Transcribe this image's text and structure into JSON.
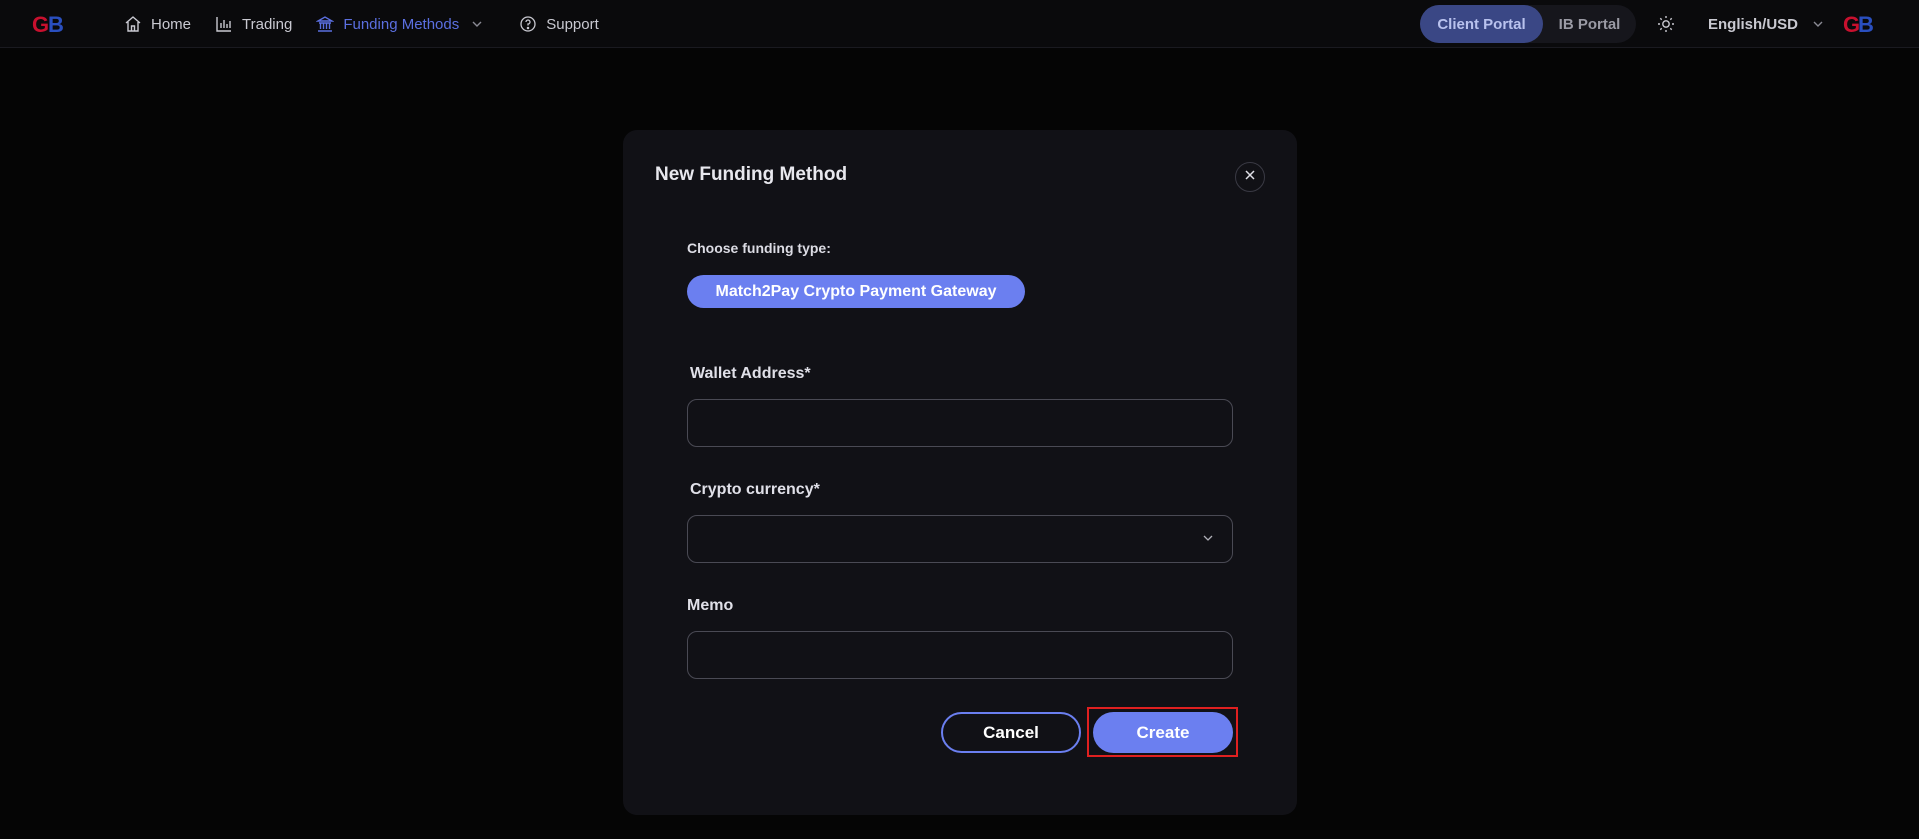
{
  "nav": {
    "items": [
      {
        "label": "Home",
        "icon": "home-icon"
      },
      {
        "label": "Trading",
        "icon": "chart-icon"
      },
      {
        "label": "Funding Methods",
        "icon": "bank-icon",
        "active": true,
        "has_dropdown": true
      },
      {
        "label": "Support",
        "icon": "help-circle-icon"
      }
    ],
    "portals": {
      "client": "Client Portal",
      "ib": "IB Portal",
      "active": "client"
    },
    "language": "English/USD",
    "theme_icon": "sun-icon"
  },
  "modal": {
    "title": "New Funding Method",
    "choose_label": "Choose funding type:",
    "funding_type": "Match2Pay Crypto Payment Gateway",
    "fields": {
      "wallet_address": {
        "label": "Wallet Address*",
        "value": ""
      },
      "crypto_currency": {
        "label": "Crypto currency*",
        "value": ""
      },
      "memo": {
        "label": "Memo",
        "value": ""
      }
    },
    "buttons": {
      "cancel": "Cancel",
      "create": "Create"
    }
  },
  "colors": {
    "background": "#050505",
    "modal": "#111116",
    "accent": "#6b7ff0",
    "active_nav": "#5b6fe0",
    "highlight": "#e02020"
  }
}
